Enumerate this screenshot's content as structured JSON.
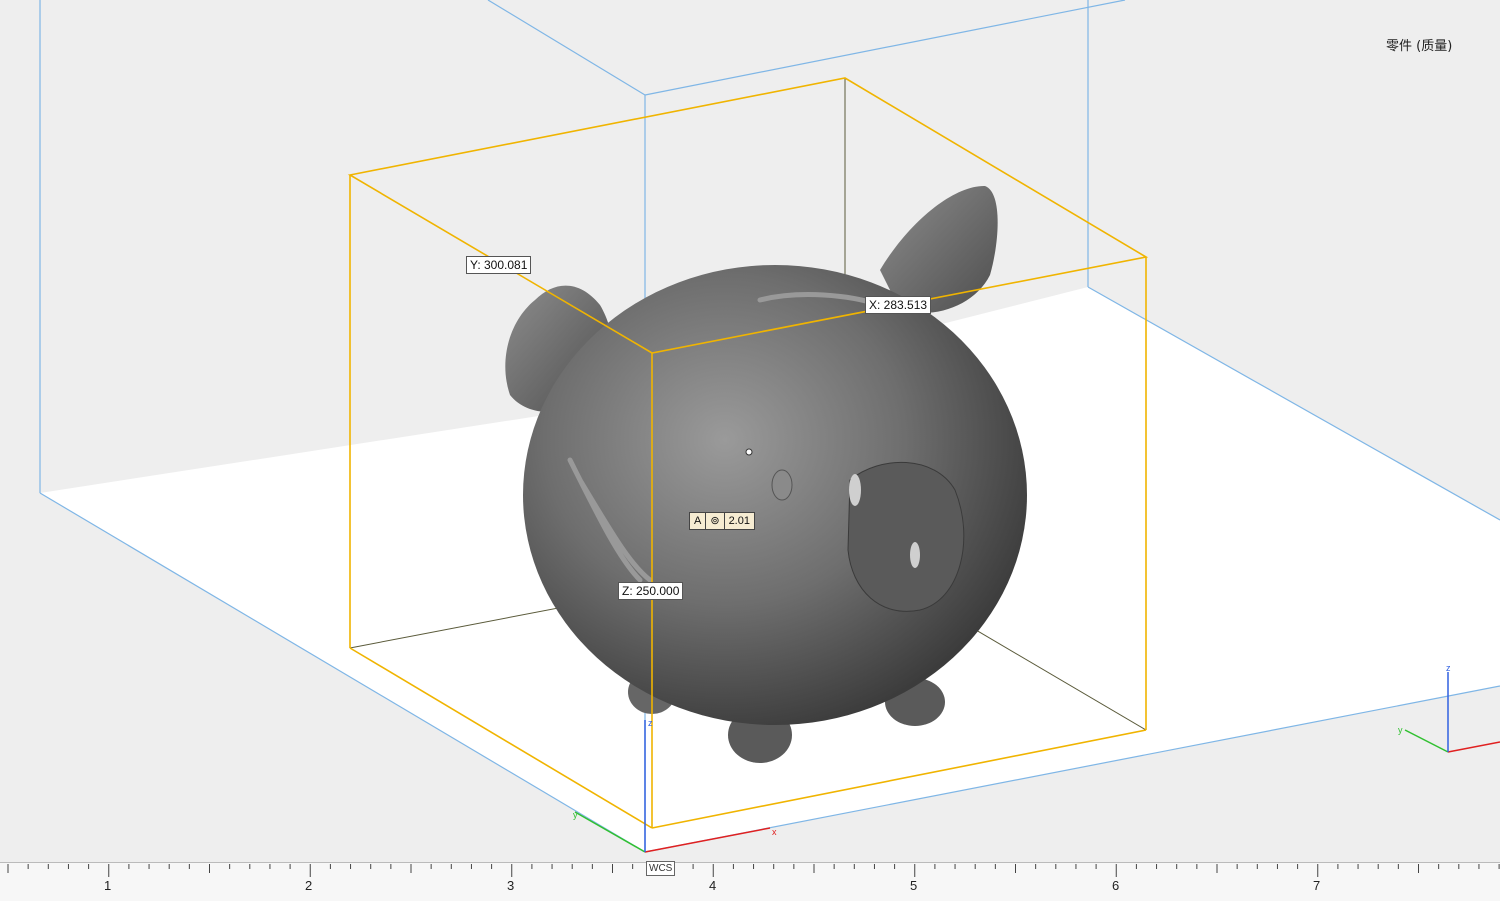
{
  "part_label": "零件 (质量)",
  "dimensions": {
    "y": "Y: 300.081",
    "x": "X: 283.513",
    "z": "Z: 250.000"
  },
  "tolerance": {
    "datum": "A",
    "symbol": "⊚",
    "value": "2.01"
  },
  "wcs_label": "WCS",
  "ruler_numbers": [
    "1",
    "2",
    "3",
    "4",
    "5",
    "6",
    "7"
  ],
  "axes": {
    "x": "x",
    "y": "y",
    "z": "z"
  },
  "colors": {
    "bounding_box": "#f0b400",
    "build_volume": "#7fb6e6",
    "x_axis": "#e02020",
    "y_axis": "#30c030",
    "z_axis": "#3060e0"
  }
}
